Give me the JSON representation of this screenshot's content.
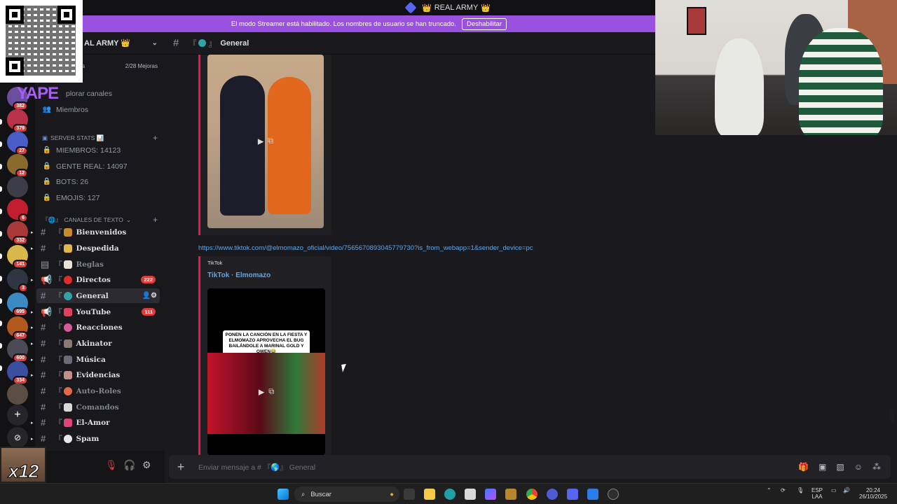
{
  "window": {
    "title": "REAL ARMY"
  },
  "streamer_bar": {
    "message": "El modo Streamer está habilitado. Los nombres de usuario se han truncado.",
    "disable_label": "Deshabilitar"
  },
  "overlay": {
    "yape": "YAPE",
    "multiplier": "x12"
  },
  "servers": [
    {
      "badge": "382",
      "color": "#6b4d9e"
    },
    {
      "badge": "379",
      "color": "#b8334a"
    },
    {
      "badge": "27",
      "color": "#4a5cc7"
    },
    {
      "badge": "12",
      "color": "#8a6a2c"
    },
    {
      "badge": "",
      "color": "#3d3d48"
    },
    {
      "badge": "6",
      "color": "#c21d2f"
    },
    {
      "badge": "332",
      "color": "#aa3a3a"
    },
    {
      "badge": "141",
      "color": "#d8b84a"
    },
    {
      "badge": "3",
      "color": "#2f3542"
    },
    {
      "badge": "695",
      "color": "#3b8ac4"
    },
    {
      "badge": "647",
      "color": "#b3591f"
    },
    {
      "badge": "600",
      "color": "#4b4b55"
    },
    {
      "badge": "334",
      "color": "#3a4fa0"
    },
    {
      "badge": "",
      "color": "#5a4e44"
    }
  ],
  "sidebar": {
    "server_name": "AL ARMY 👑",
    "boosts_left": "ras",
    "boosts_right": "2/28 Mejoras",
    "explore": "plorar canales",
    "members": "Miembros",
    "stats_category": "SERVER STATS 📊",
    "stats": [
      "MIEMBROS: 14123",
      "GENTE REAL: 14097",
      "BOTS: 26",
      "EMOJIS: 127"
    ],
    "text_category": "CANALES DE TEXTO",
    "channels": [
      {
        "name": "Bienvenidos",
        "emoji": "#c9892c",
        "badge": ""
      },
      {
        "name": "Despedida",
        "emoji": "#e0b84a",
        "badge": ""
      },
      {
        "name": "Reglas",
        "emoji": "#e9e2d6",
        "badge": ""
      },
      {
        "name": "Directos",
        "emoji": "#e42b2b",
        "badge": "222"
      },
      {
        "name": "General",
        "emoji": "#2fa3a8",
        "badge": ""
      },
      {
        "name": "YouTube",
        "emoji": "#e0405a",
        "badge": "111"
      },
      {
        "name": "Reacciones",
        "emoji": "#d65b9a",
        "badge": ""
      },
      {
        "name": "Akinator",
        "emoji": "#8a7b72",
        "badge": ""
      },
      {
        "name": "Música",
        "emoji": "#6b6b78",
        "badge": ""
      },
      {
        "name": "Evidencias",
        "emoji": "#c28f86",
        "badge": ""
      },
      {
        "name": "Auto-Roles",
        "emoji": "#e06a4a",
        "badge": ""
      },
      {
        "name": "Comandos",
        "emoji": "#d9d9d9",
        "badge": ""
      },
      {
        "name": "El-Amor",
        "emoji": "#e04577",
        "badge": ""
      },
      {
        "name": "Spam",
        "emoji": "#e8e8e8",
        "badge": ""
      }
    ]
  },
  "channel": {
    "name": "General"
  },
  "messages": {
    "link": "https://www.tiktok.com/@elmomazo_oficial/video/7565670893045779730?is_from_webapp=1&sender_device=pc",
    "provider": "TikTok",
    "author": "TikTok · Elmomazo",
    "caption": "PONEN LA CANCIÓN EN LA FIESTA Y ELMOMAZO APROVECHA EL BUG BAILÁNDOLE A MARINAL GOLD Y OWEN😂"
  },
  "composer": {
    "placeholder": "Enviar mensaje a # 『🌎』 General"
  },
  "taskbar": {
    "search": "Buscar",
    "lang_top": "ESP",
    "lang_bottom": "LAA",
    "time": "20:24",
    "date": "26/10/2025"
  }
}
